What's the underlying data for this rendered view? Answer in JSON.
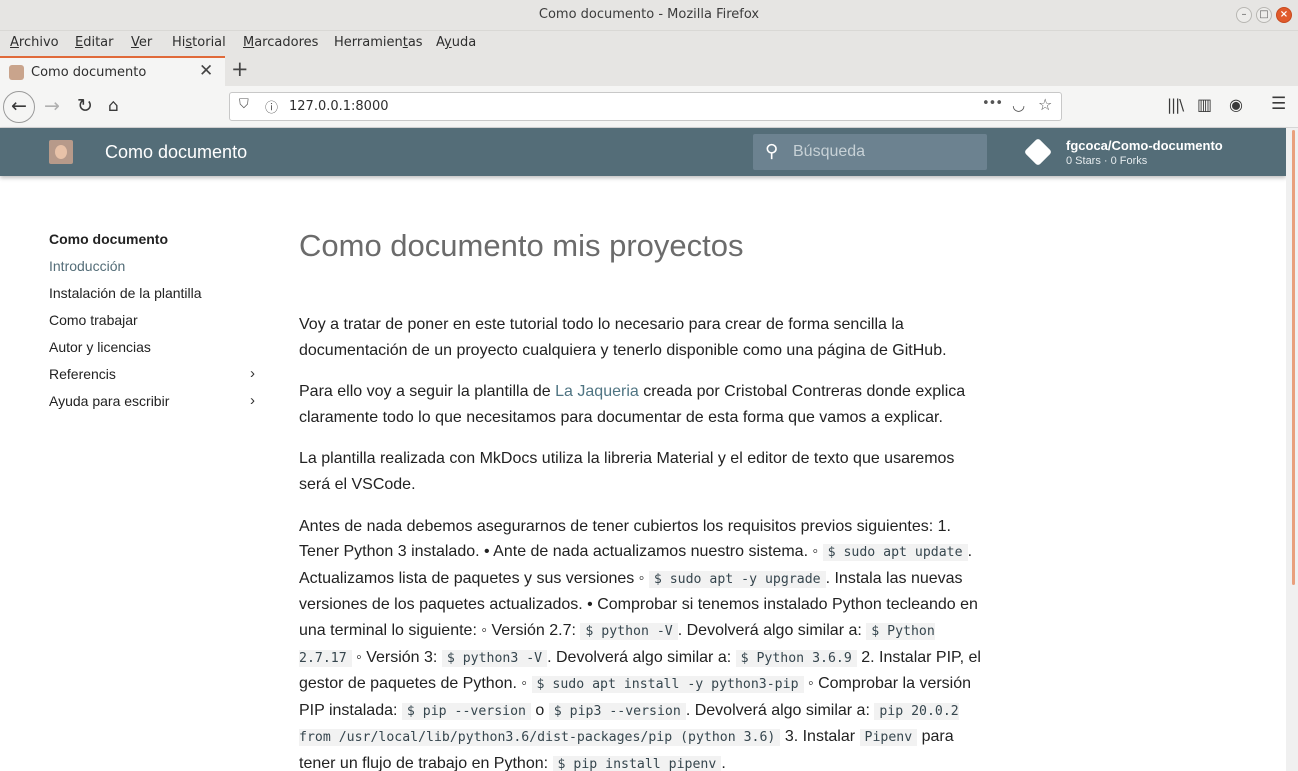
{
  "window": {
    "title": "Como documento - Mozilla Firefox"
  },
  "menubar": {
    "items": [
      {
        "pre": "",
        "u": "A",
        "post": "rchivo"
      },
      {
        "pre": "",
        "u": "E",
        "post": "ditar"
      },
      {
        "pre": "",
        "u": "V",
        "post": "er"
      },
      {
        "pre": "Hi",
        "u": "s",
        "post": "torial"
      },
      {
        "pre": "",
        "u": "M",
        "post": "arcadores"
      },
      {
        "pre": "Herramien",
        "u": "t",
        "post": "as"
      },
      {
        "pre": "A",
        "u": "y",
        "post": "uda"
      }
    ]
  },
  "tab": {
    "label": "Como documento",
    "close": "✕",
    "new_tab": "+"
  },
  "navbar": {
    "url": "127.0.0.1:8000",
    "more": "•••"
  },
  "header": {
    "site_title": "Como documento",
    "search_placeholder": "Búsqueda",
    "repo_name": "fgcoca/Como-documento",
    "repo_stats": "0 Stars · 0 Forks"
  },
  "sidebar": {
    "title": "Como documento",
    "items": [
      {
        "label": "Introducción",
        "active": true,
        "expandable": false
      },
      {
        "label": "Instalación de la plantilla",
        "active": false,
        "expandable": false
      },
      {
        "label": "Como trabajar",
        "active": false,
        "expandable": false
      },
      {
        "label": "Autor y licencias",
        "active": false,
        "expandable": false
      },
      {
        "label": "Referencis",
        "active": false,
        "expandable": true
      },
      {
        "label": "Ayuda para escribir",
        "active": false,
        "expandable": true
      }
    ]
  },
  "content": {
    "heading": "Como documento mis proyectos",
    "p1": "Voy a tratar de poner en este tutorial todo lo necesario para crear de forma sencilla la documentación de un proyecto cualquiera y tenerlo disponible como una página de GitHub.",
    "p2_before": "Para ello voy a seguir la plantilla de ",
    "p2_link": "La Jaqueria",
    "p2_after": " creada por Cristobal Contreras donde explica claramente todo lo que necesitamos para documentar de esta forma que vamos a explicar.",
    "p3": "La plantilla realizada con MkDocs utiliza la libreria Material y el editor de texto que usaremos será el VSCode.",
    "p4": [
      {
        "t": "text",
        "v": "Antes de nada debemos asegurarnos de tener cubiertos los requisitos previos siguientes: 1. Tener Python 3 instalado. • Ante de nada actualizamos nuestro sistema. ◦ "
      },
      {
        "t": "code",
        "v": "$ sudo apt update"
      },
      {
        "t": "text",
        "v": ". Actualizamos lista de paquetes y sus versiones ◦ "
      },
      {
        "t": "code",
        "v": "$ sudo apt -y upgrade"
      },
      {
        "t": "text",
        "v": ". Instala las nuevas versiones de los paquetes actualizados. • Comprobar si tenemos instalado Python tecleando en una terminal lo siguiente: ◦ Versión 2.7: "
      },
      {
        "t": "code",
        "v": "$ python -V"
      },
      {
        "t": "text",
        "v": ". Devolverá algo similar a: "
      },
      {
        "t": "code",
        "v": "$ Python 2.7.17"
      },
      {
        "t": "text",
        "v": " ◦ Versión 3: "
      },
      {
        "t": "code",
        "v": "$ python3 -V"
      },
      {
        "t": "text",
        "v": ". Devolverá algo similar a: "
      },
      {
        "t": "code",
        "v": "$ Python 3.6.9"
      },
      {
        "t": "text",
        "v": " 2. Instalar PIP, el gestor de paquetes de Python. ◦ "
      },
      {
        "t": "code",
        "v": "$ sudo apt install -y python3-pip"
      },
      {
        "t": "text",
        "v": " ◦ Comprobar la versión PIP instalada: "
      },
      {
        "t": "code",
        "v": "$ pip --version"
      },
      {
        "t": "text",
        "v": " o "
      },
      {
        "t": "code",
        "v": "$ pip3 --version"
      },
      {
        "t": "text",
        "v": ". Devolverá algo similar a: "
      },
      {
        "t": "code",
        "v": "pip 20.0.2 from /usr/local/lib/python3.6/dist-packages/pip (python 3.6)"
      },
      {
        "t": "text",
        "v": " 3. Instalar "
      },
      {
        "t": "code",
        "v": "Pipenv"
      },
      {
        "t": "text",
        "v": " para tener un flujo de trabajo en Python: "
      },
      {
        "t": "code",
        "v": "$ pip install pipenv"
      },
      {
        "t": "text",
        "v": "."
      }
    ]
  }
}
